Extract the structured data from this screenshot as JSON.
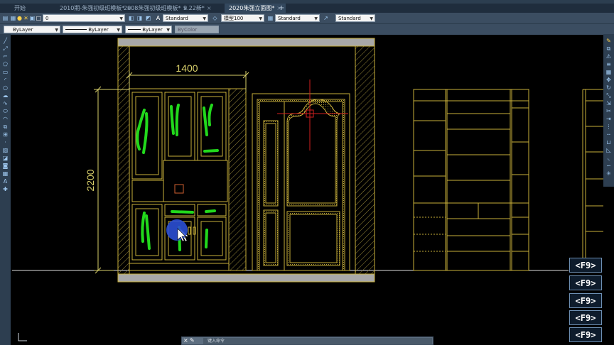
{
  "tabs": [
    {
      "label": "开始",
      "active": false
    },
    {
      "label": "2010期-朱强初级班模板*",
      "active": false
    },
    {
      "label": "2008朱强初级班模板*",
      "active": false
    },
    {
      "label": "9.22新*",
      "active": false
    },
    {
      "label": "2020朱强立面图*",
      "active": true
    }
  ],
  "toolbar": {
    "layer_value": "0",
    "text_style": "Standard",
    "dim_style": "模型100",
    "table_style": "Standard",
    "multileader_style": "Standard"
  },
  "properties": {
    "color": "ByLayer",
    "linetype": "ByLayer",
    "lineweight": "ByLayer",
    "plotstyle": "ByColor"
  },
  "drawing": {
    "dim_width": "1400",
    "dim_height": "2200"
  },
  "f9_buttons": [
    "<F9>",
    "<F9>",
    "<F9>",
    "<F9>",
    "<F9>"
  ],
  "command": {
    "placeholder": "键入命令"
  },
  "colors": {
    "drawing_lines": "#c9b03a",
    "dimension": "#d8cf6a",
    "crosshair": "#d41f1f",
    "annotation": "#22d91c",
    "cursor": "#2b4fd4"
  }
}
